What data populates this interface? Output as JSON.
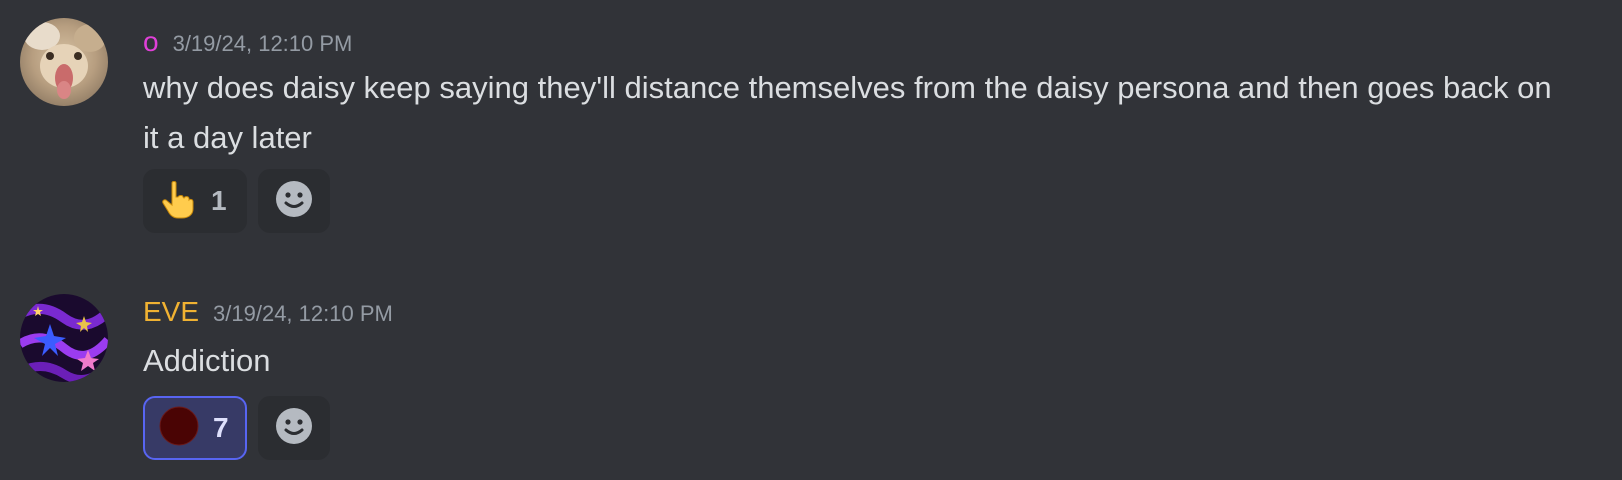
{
  "messages": [
    {
      "username": "o",
      "username_color": "#e040d8",
      "timestamp": "3/19/24, 12:10 PM",
      "content": "why does daisy keep saying they'll distance themselves from the daisy persona and then goes back on it a day later",
      "avatar": "cat-avatar",
      "reactions": [
        {
          "emoji": "pointing-up-hand-icon",
          "count": "1",
          "selected": false
        }
      ]
    },
    {
      "username": "EVE",
      "username_color": "#f0b232",
      "timestamp": "3/19/24, 12:10 PM",
      "content": "Addiction",
      "avatar": "starry-avatar",
      "reactions": [
        {
          "emoji": "dark-red-circle-icon",
          "count": "7",
          "selected": true
        }
      ]
    }
  ],
  "colors": {
    "background": "#313338",
    "text": "#dbdee1",
    "timestamp": "#949ba4",
    "reaction_bg": "#2b2d31",
    "reaction_selected_bg": "#373a66",
    "reaction_selected_border": "#5865f2"
  },
  "add_reaction_icon": "smiley-face-icon"
}
